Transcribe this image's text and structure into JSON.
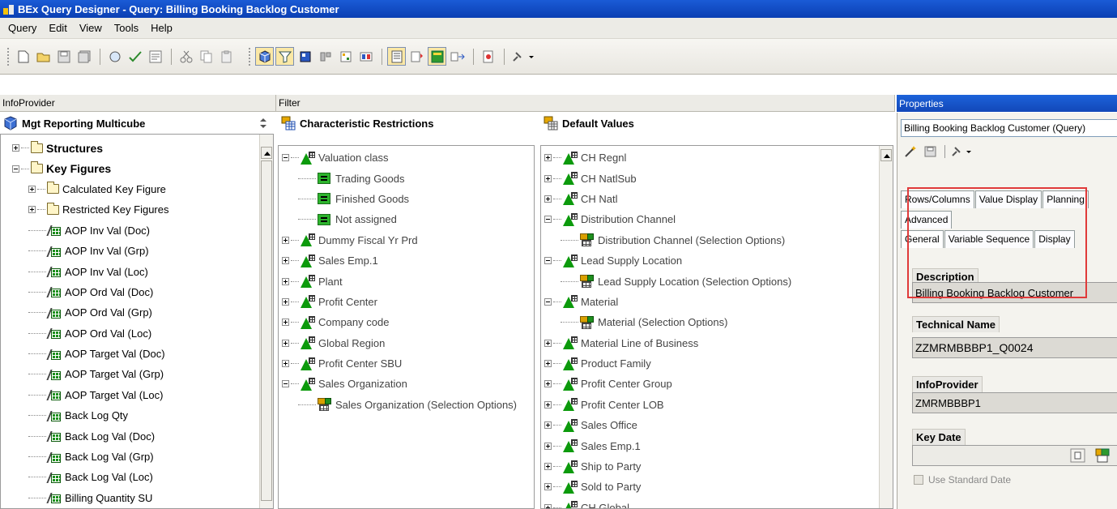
{
  "window": {
    "title": "BEx Query Designer - Query: Billing Booking Backlog Customer"
  },
  "menu": [
    "Query",
    "Edit",
    "View",
    "Tools",
    "Help"
  ],
  "panels": {
    "infoprovider": {
      "header": "InfoProvider",
      "title": "Mgt Reporting Multicube",
      "tree": [
        {
          "label": "Structures",
          "level": 0,
          "type": "folder",
          "expander": "plus",
          "bold": true
        },
        {
          "label": "Key Figures",
          "level": 0,
          "type": "folder",
          "expander": "minus",
          "bold": true
        },
        {
          "label": "Calculated Key Figure",
          "level": 1,
          "type": "folder",
          "expander": "plus"
        },
        {
          "label": "Restricted Key Figures",
          "level": 1,
          "type": "folder",
          "expander": "plus"
        },
        {
          "label": "AOP Inv Val (Doc)",
          "level": 1,
          "type": "kf"
        },
        {
          "label": "AOP Inv Val (Grp)",
          "level": 1,
          "type": "kf"
        },
        {
          "label": "AOP Inv Val (Loc)",
          "level": 1,
          "type": "kf"
        },
        {
          "label": "AOP Ord Val (Doc)",
          "level": 1,
          "type": "kf"
        },
        {
          "label": "AOP Ord Val (Grp)",
          "level": 1,
          "type": "kf"
        },
        {
          "label": "AOP Ord Val (Loc)",
          "level": 1,
          "type": "kf"
        },
        {
          "label": "AOP Target Val (Doc)",
          "level": 1,
          "type": "kf"
        },
        {
          "label": "AOP Target Val (Grp)",
          "level": 1,
          "type": "kf"
        },
        {
          "label": "AOP Target Val (Loc)",
          "level": 1,
          "type": "kf"
        },
        {
          "label": "Back Log Qty",
          "level": 1,
          "type": "kf"
        },
        {
          "label": "Back Log Val (Doc)",
          "level": 1,
          "type": "kf"
        },
        {
          "label": "Back Log Val (Grp)",
          "level": 1,
          "type": "kf"
        },
        {
          "label": "Back Log Val (Loc)",
          "level": 1,
          "type": "kf"
        },
        {
          "label": "Billing Quantity SU",
          "level": 1,
          "type": "kf"
        }
      ]
    },
    "filter": {
      "header": "Filter",
      "characteristic_restrictions": {
        "title": "Characteristic Restrictions",
        "tree": [
          {
            "label": "Valuation class",
            "level": 0,
            "type": "char",
            "expander": "minus"
          },
          {
            "label": "Trading Goods",
            "level": 1,
            "type": "val"
          },
          {
            "label": "Finished Goods",
            "level": 1,
            "type": "val"
          },
          {
            "label": "Not assigned",
            "level": 1,
            "type": "val"
          },
          {
            "label": "Dummy Fiscal Yr Prd",
            "level": 0,
            "type": "char",
            "expander": "plus"
          },
          {
            "label": "Sales Emp.1",
            "level": 0,
            "type": "char",
            "expander": "plus"
          },
          {
            "label": "Plant",
            "level": 0,
            "type": "char",
            "expander": "plus"
          },
          {
            "label": "Profit Center",
            "level": 0,
            "type": "char",
            "expander": "plus"
          },
          {
            "label": "Company code",
            "level": 0,
            "type": "char",
            "expander": "plus"
          },
          {
            "label": "Global Region",
            "level": 0,
            "type": "char",
            "expander": "plus"
          },
          {
            "label": "Profit Center SBU",
            "level": 0,
            "type": "char",
            "expander": "plus"
          },
          {
            "label": "Sales Organization",
            "level": 0,
            "type": "char",
            "expander": "minus"
          },
          {
            "label": "Sales Organization (Selection Options)",
            "level": 1,
            "type": "sel"
          }
        ]
      },
      "default_values": {
        "title": "Default Values",
        "tree": [
          {
            "label": "CH Regnl",
            "level": 0,
            "type": "char",
            "expander": "plus"
          },
          {
            "label": "CH NatlSub",
            "level": 0,
            "type": "char",
            "expander": "plus"
          },
          {
            "label": "CH Natl",
            "level": 0,
            "type": "char",
            "expander": "plus"
          },
          {
            "label": "Distribution Channel",
            "level": 0,
            "type": "char",
            "expander": "minus"
          },
          {
            "label": "Distribution Channel (Selection Options)",
            "level": 1,
            "type": "sel"
          },
          {
            "label": "Lead Supply Location",
            "level": 0,
            "type": "char",
            "expander": "minus"
          },
          {
            "label": "Lead Supply Location (Selection Options)",
            "level": 1,
            "type": "sel"
          },
          {
            "label": "Material",
            "level": 0,
            "type": "char",
            "expander": "minus"
          },
          {
            "label": "Material (Selection Options)",
            "level": 1,
            "type": "sel"
          },
          {
            "label": "Material Line of Business",
            "level": 0,
            "type": "char",
            "expander": "plus"
          },
          {
            "label": "Product Family",
            "level": 0,
            "type": "char",
            "expander": "plus"
          },
          {
            "label": "Profit Center Group",
            "level": 0,
            "type": "char",
            "expander": "plus"
          },
          {
            "label": "Profit Center LOB",
            "level": 0,
            "type": "char",
            "expander": "plus"
          },
          {
            "label": "Sales Office",
            "level": 0,
            "type": "char",
            "expander": "plus"
          },
          {
            "label": "Sales Emp.1",
            "level": 0,
            "type": "char",
            "expander": "plus"
          },
          {
            "label": "Ship to Party",
            "level": 0,
            "type": "char",
            "expander": "plus"
          },
          {
            "label": "Sold to Party",
            "level": 0,
            "type": "char",
            "expander": "plus"
          },
          {
            "label": "CH Global",
            "level": 0,
            "type": "char",
            "expander": "plus"
          }
        ]
      }
    },
    "properties": {
      "header": "Properties",
      "combo_value": "Billing Booking Backlog Customer (Query)",
      "tabs_row1": [
        "Rows/Columns",
        "Value Display",
        "Planning"
      ],
      "tabs_row2": [
        "Advanced"
      ],
      "tabs_row3": [
        "General",
        "Variable Sequence",
        "Display"
      ],
      "description_label": "Description",
      "description_value": "Billing Booking Backlog Customer",
      "technical_name_label": "Technical Name",
      "technical_name_value": "ZZMRMBBBP1_Q0024",
      "infoprovider_label": "InfoProvider",
      "infoprovider_value": "ZMRMBBBP1",
      "key_date_label": "Key Date",
      "key_date_value": "",
      "use_standard_date_label": "Use Standard Date"
    }
  },
  "colors": {
    "titlebar": "#0b3fb3",
    "highlight_box": "#e03a3a",
    "char_icon": "#0c9a0c"
  }
}
